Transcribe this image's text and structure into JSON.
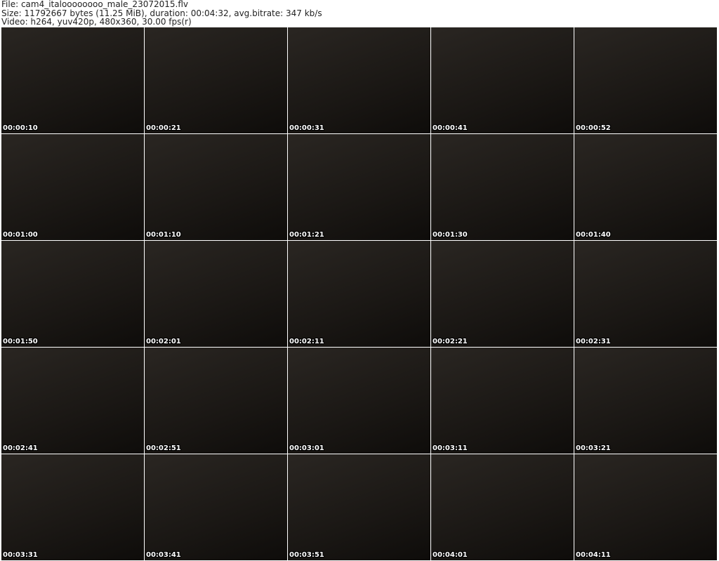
{
  "header": {
    "file": "File: cam4_italoooooooo_male_23072015.flv",
    "size": "Size: 11792667 bytes (11.25 MiB), duration: 00:04:32, avg.bitrate: 347 kb/s",
    "video": "Video: h264, yuv420p, 480x360, 30.00 fps(r)"
  },
  "thumbnails": [
    "00:00:10",
    "00:00:21",
    "00:00:31",
    "00:00:41",
    "00:00:52",
    "00:01:00",
    "00:01:10",
    "00:01:21",
    "00:01:30",
    "00:01:40",
    "00:01:50",
    "00:02:01",
    "00:02:11",
    "00:02:21",
    "00:02:31",
    "00:02:41",
    "00:02:51",
    "00:03:01",
    "00:03:11",
    "00:03:21",
    "00:03:31",
    "00:03:41",
    "00:03:51",
    "00:04:01",
    "00:04:11"
  ]
}
